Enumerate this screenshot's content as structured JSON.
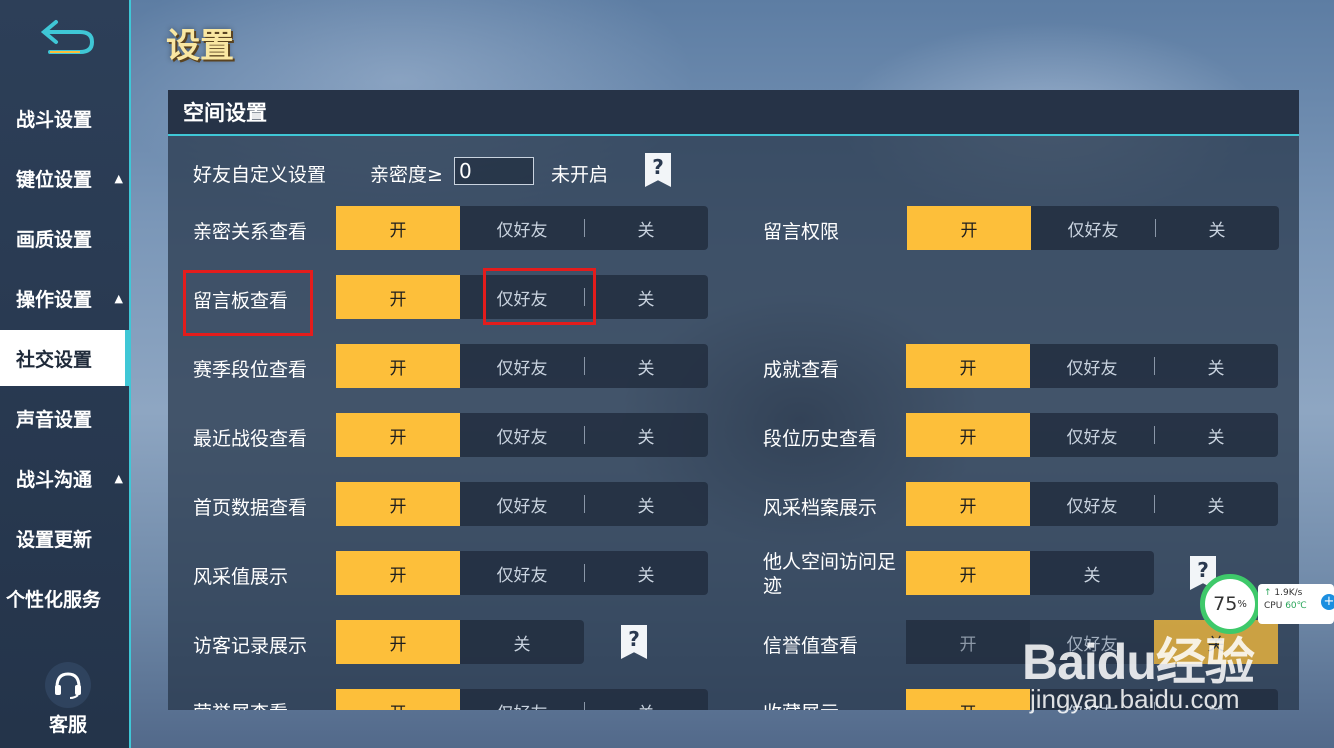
{
  "page_title": "设置",
  "sidebar": {
    "items": [
      {
        "label": "战斗设置",
        "caret": ""
      },
      {
        "label": "键位设置",
        "caret": "▲"
      },
      {
        "label": "画质设置",
        "caret": ""
      },
      {
        "label": "操作设置",
        "caret": "▲"
      },
      {
        "label": "社交设置",
        "caret": ""
      },
      {
        "label": "声音设置",
        "caret": ""
      },
      {
        "label": "战斗沟通",
        "caret": "▲"
      },
      {
        "label": "设置更新",
        "caret": ""
      },
      {
        "label": "个性化服务",
        "caret": ""
      }
    ],
    "service_label": "客服"
  },
  "panel": {
    "header": "空间设置",
    "friend_custom": {
      "label": "好友自定义设置",
      "intimacy_label": "亲密度≥",
      "intimacy_value": "0",
      "status": "未开启",
      "help": "?"
    },
    "options": {
      "on": "开",
      "friends": "仅好友",
      "off": "关"
    },
    "left_rows": [
      {
        "label": "亲密关系查看"
      },
      {
        "label": "留言板查看"
      },
      {
        "label": "赛季段位查看"
      },
      {
        "label": "最近战役查看"
      },
      {
        "label": "首页数据查看"
      },
      {
        "label": "风采值展示"
      },
      {
        "label": "访客记录展示"
      },
      {
        "label": "荣誉展查看"
      }
    ],
    "right_rows": [
      {
        "label": "留言权限"
      },
      {
        "label": "成就查看"
      },
      {
        "label": "段位历史查看"
      },
      {
        "label": "风采档案展示"
      },
      {
        "label": "他人空间访问足迹"
      },
      {
        "label": "信誉值查看"
      },
      {
        "label": "收藏展示"
      }
    ],
    "help_mark": "?"
  },
  "perf": {
    "percent": "75",
    "percent_unit": "%",
    "net": "1.9K/s",
    "cpu_label": "CPU",
    "cpu_temp": "60℃",
    "plus": "+"
  },
  "watermark": {
    "logo": "Baidu经验",
    "url": "jingyan.baidu.com"
  },
  "colors": {
    "accent": "#fdbf3a",
    "teal": "#3fc7d6",
    "highlight": "#e41c1c"
  }
}
